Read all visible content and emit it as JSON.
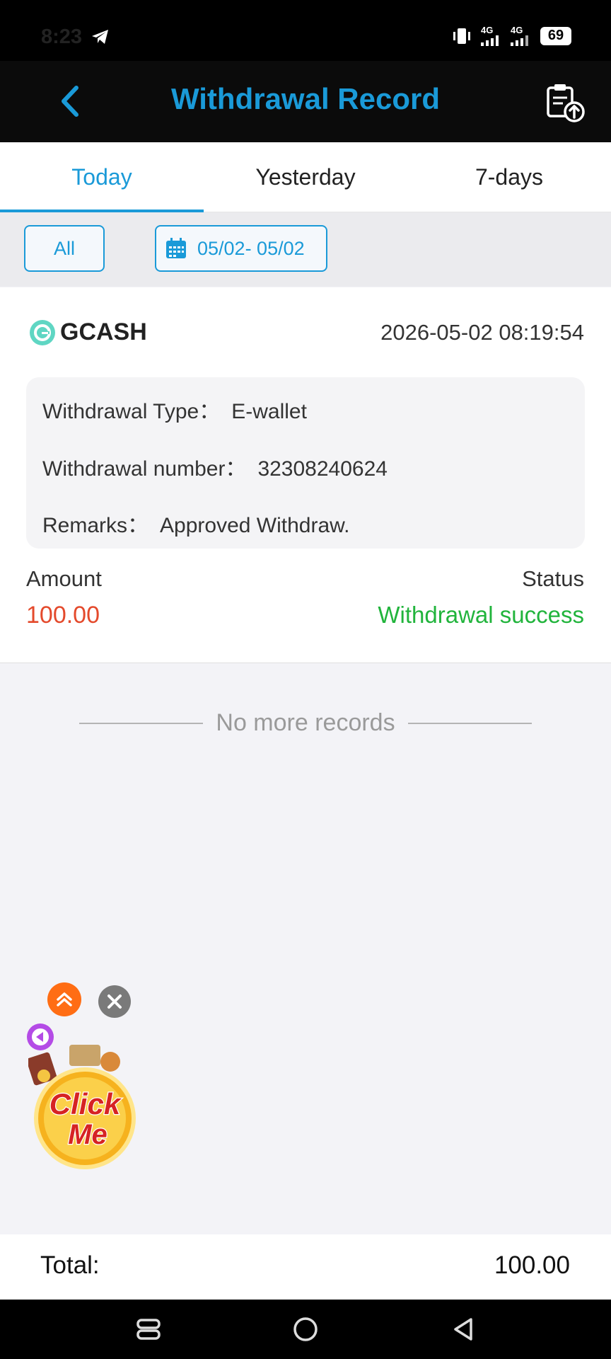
{
  "status_bar": {
    "time": "8:23",
    "network_1": "4G",
    "network_2": "4G",
    "battery": "69"
  },
  "header": {
    "title": "Withdrawal Record"
  },
  "tabs": [
    {
      "label": "Today",
      "active": true
    },
    {
      "label": "Yesterday",
      "active": false
    },
    {
      "label": "7-days",
      "active": false
    }
  ],
  "filters": {
    "type_label": "All",
    "date_range": "05/02- 05/02"
  },
  "record": {
    "method": "GCASH",
    "datetime": "2026-05-02 08:19:54",
    "type_label": "Withdrawal Type：",
    "type_value": "E-wallet",
    "number_label": "Withdrawal number：",
    "number_value": "32308240624",
    "remarks_label": "Remarks：",
    "remarks_value": "Approved Withdraw.",
    "amount_label": "Amount",
    "amount_value": "100.00",
    "status_label": "Status",
    "status_value": "Withdrawal success"
  },
  "list_end_text": "No more records",
  "promo": {
    "label_line1": "Click",
    "label_line2": "Me"
  },
  "footer": {
    "total_label": "Total:",
    "total_value": "100.00"
  },
  "colors": {
    "accent": "#1a9ad8",
    "amount": "#e44a2c",
    "success": "#21b43c"
  }
}
